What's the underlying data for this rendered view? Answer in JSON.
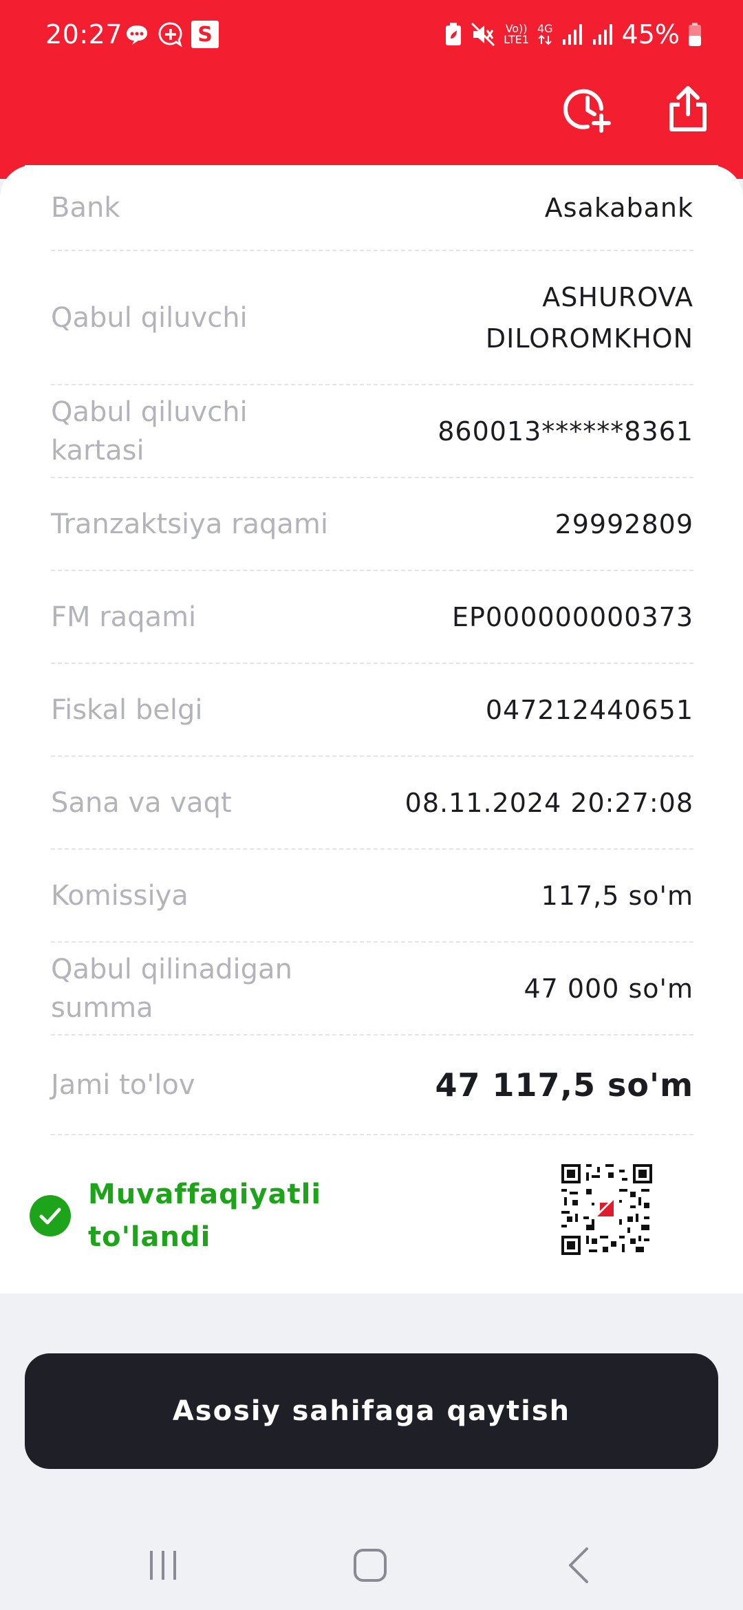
{
  "status_bar": {
    "time": "20:27",
    "battery_pct": "45%",
    "network_top": "Vo))",
    "network_bottom": "LTE1",
    "network_gen": "4G",
    "left_icons": [
      "chat-bubble-icon",
      "plus-bubble-icon",
      "s-app-icon"
    ],
    "right_icons": [
      "battery-saver-icon",
      "mute-icon",
      "volte-icon",
      "4g-icon",
      "signal-icon",
      "signal-icon",
      "battery-icon"
    ],
    "s_badge": "S"
  },
  "header": {
    "actions": [
      "clock-plus-icon",
      "share-icon"
    ]
  },
  "receipt": {
    "rows": [
      {
        "label": "Bank",
        "value": "Asakabank"
      },
      {
        "label": "Qabul qiluvchi",
        "value": "ASHUROVA DILOROMKHON"
      },
      {
        "label": "Qabul qiluvchi kartasi",
        "value": "860013******8361"
      },
      {
        "label": "Tranzaktsiya raqami",
        "value": "29992809"
      },
      {
        "label": "FM raqami",
        "value": "EP000000000373"
      },
      {
        "label": "Fiskal belgi",
        "value": "047212440651"
      },
      {
        "label": "Sana va vaqt",
        "value": "08.11.2024 20:27:08"
      },
      {
        "label": "Komissiya",
        "value": "117,5 so'm"
      },
      {
        "label": "Qabul qilinadigan summa",
        "value": "47 000 so'm"
      },
      {
        "label": "Jami to'lov",
        "value": "47 117,5 so'm"
      }
    ],
    "status_text": "Muvaffaqiyatli to'landi"
  },
  "home_button": {
    "label": "Asosiy sahifaga qaytish"
  },
  "colors": {
    "brand_red": "#f31e30",
    "success_green": "#1ea41a",
    "button_dark": "#1f2027",
    "label_gray": "#b3b4bb"
  },
  "nav": [
    "recents-icon",
    "home-icon",
    "back-icon"
  ]
}
